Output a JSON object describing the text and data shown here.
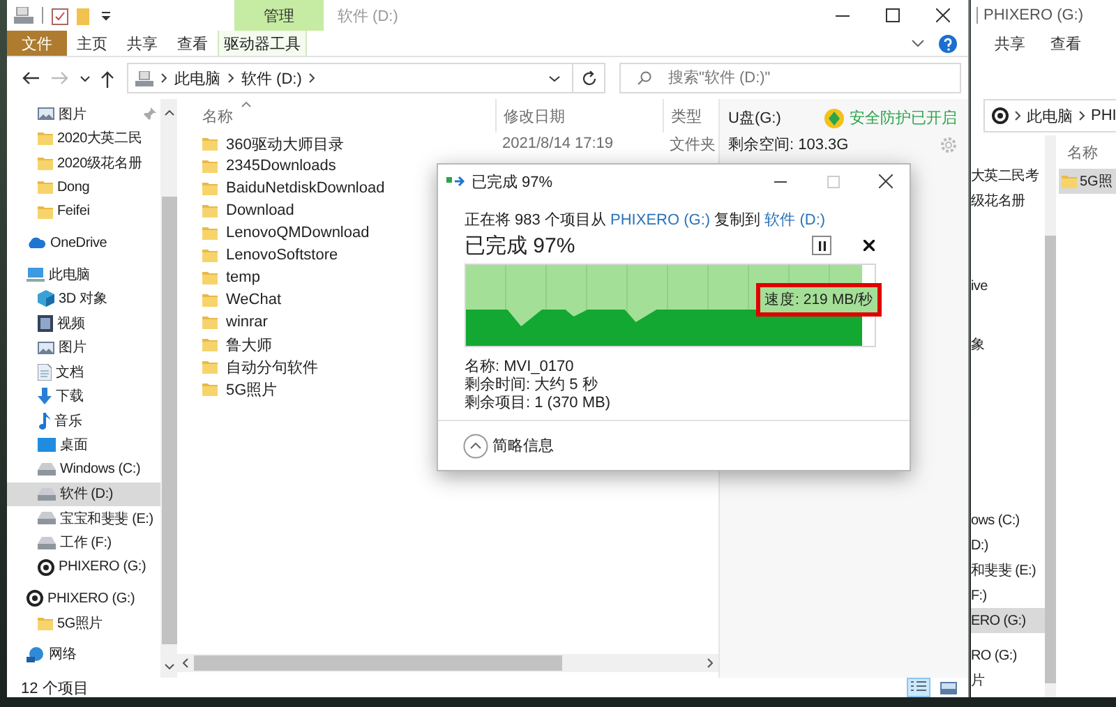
{
  "main_window": {
    "title": "软件 (D:)",
    "ribbon": {
      "file_tab": "文件",
      "tabs": [
        "主页",
        "共享",
        "查看"
      ],
      "context_group": "管理",
      "context_tab": "驱动器工具"
    },
    "breadcrumb": [
      "此电脑",
      "软件 (D:)"
    ],
    "search": {
      "placeholder": "搜索\"软件 (D:)\""
    },
    "nav": {
      "quick_access": [
        {
          "label": "图片",
          "kind": "image",
          "pinned": true,
          "selected": false
        },
        {
          "label": "2020大英二民",
          "kind": "folder",
          "pinned": false,
          "selected": false
        },
        {
          "label": "2020级花名册",
          "kind": "folder",
          "pinned": false,
          "selected": false
        },
        {
          "label": "Dong",
          "kind": "folder",
          "pinned": false,
          "selected": false
        },
        {
          "label": "Feifei",
          "kind": "folder",
          "pinned": false,
          "selected": false
        }
      ],
      "tree": [
        {
          "label": "OneDrive",
          "kind": "cloud",
          "selected": false
        },
        {
          "label": "此电脑",
          "kind": "computer",
          "selected": false,
          "children": [
            {
              "label": "3D 对象",
              "kind": "cube",
              "selected": false
            },
            {
              "label": "视频",
              "kind": "film",
              "selected": false
            },
            {
              "label": "图片",
              "kind": "image",
              "selected": false
            },
            {
              "label": "文档",
              "kind": "document",
              "selected": false
            },
            {
              "label": "下载",
              "kind": "download",
              "selected": false
            },
            {
              "label": "音乐",
              "kind": "music",
              "selected": false
            },
            {
              "label": "桌面",
              "kind": "desktop",
              "selected": false
            },
            {
              "label": "Windows (C:)",
              "kind": "drive",
              "selected": false
            },
            {
              "label": "软件 (D:)",
              "kind": "drive",
              "selected": true
            },
            {
              "label": "宝宝和斐斐 (E:)",
              "kind": "drive",
              "selected": false
            },
            {
              "label": "工作 (F:)",
              "kind": "drive",
              "selected": false
            },
            {
              "label": "PHIXERO (G:)",
              "kind": "disc",
              "selected": false
            }
          ]
        },
        {
          "label": "PHIXERO (G:)",
          "kind": "disc",
          "selected": false,
          "children": [
            {
              "label": "5G照片",
              "kind": "folder",
              "selected": false
            }
          ]
        },
        {
          "label": "网络",
          "kind": "network",
          "selected": false
        }
      ]
    },
    "columns": [
      "名称",
      "修改日期",
      "类型"
    ],
    "files": [
      {
        "name": "360驱动大师目录",
        "date": "2021/8/14 17:19",
        "type": "文件夹"
      },
      {
        "name": "2345Downloads"
      },
      {
        "name": "BaiduNetdiskDownload"
      },
      {
        "name": "Download"
      },
      {
        "name": "LenovoQMDownload"
      },
      {
        "name": "LenovoSoftstore"
      },
      {
        "name": "temp"
      },
      {
        "name": "WeChat"
      },
      {
        "name": "winrar"
      },
      {
        "name": "鲁大师"
      },
      {
        "name": "自动分句软件"
      },
      {
        "name": "5G照片"
      }
    ],
    "drive_info": {
      "name": "U盘(G:)",
      "protection": "安全防护已开启",
      "free_space": "剩余空间: 103.3G"
    },
    "status_bar": {
      "count": "12 个项目",
      "view_buttons": [
        {
          "kind": "details",
          "selected": true
        },
        {
          "kind": "tiles",
          "selected": false
        }
      ]
    }
  },
  "copy_dialog": {
    "title": "已完成 97%",
    "summary": [
      {
        "kind": "text",
        "text": "正在将 983 个项目从 "
      },
      {
        "kind": "link",
        "text": "PHIXERO (G:)"
      },
      {
        "kind": "text",
        "text": " 复制到 "
      },
      {
        "kind": "link",
        "text": "软件 (D:)"
      }
    ],
    "heading": "已完成 97%",
    "progress": {
      "level": 0.97
    },
    "speed": "速度: 219 MB/秒",
    "speed_highlighted": true,
    "details": [
      "名称: MVI_0170",
      "剩余时间: 大约 5 秒",
      "剩余项目: 1 (370 MB)"
    ],
    "footer": "简略信息"
  },
  "second_window": {
    "title": "PHIXERO (G:)",
    "tabs": [
      "共享",
      "查看"
    ],
    "breadcrumb": [
      "此电脑",
      "PHI"
    ],
    "nav": [
      {
        "label": "大英二民考",
        "selected": false
      },
      {
        "label": "级花名册",
        "selected": false
      },
      {
        "label": "ive",
        "selected": false
      },
      {
        "label": "象",
        "selected": false
      },
      {
        "label": "ows (C:)",
        "selected": false
      },
      {
        "label": "D:)",
        "selected": false
      },
      {
        "label": "和斐斐 (E:)",
        "selected": false
      },
      {
        "label": "F:)",
        "selected": false
      },
      {
        "label": "ERO (G:)",
        "selected": true
      },
      {
        "label": "RO (G:)",
        "selected": false
      },
      {
        "label": "片",
        "selected": false
      }
    ],
    "column": "名称",
    "files": [
      {
        "name": "5G照",
        "selected": true
      }
    ]
  }
}
